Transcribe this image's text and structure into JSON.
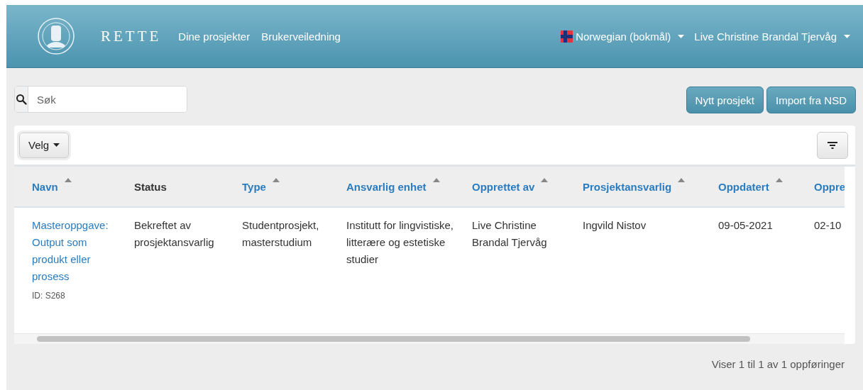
{
  "header": {
    "brand": "RETTE",
    "nav": [
      {
        "label": "Dine prosjekter"
      },
      {
        "label": "Brukerveiledning"
      }
    ],
    "language": "Norwegian (bokmål)",
    "user": "Live Christine Brandal Tjervåg"
  },
  "search": {
    "placeholder": "Søk"
  },
  "actions": [
    {
      "label": "Nytt prosjekt"
    },
    {
      "label": "Import fra NSD"
    }
  ],
  "table": {
    "select_button": "Velg",
    "columns": [
      {
        "label": "Navn",
        "link": true,
        "sortable": true
      },
      {
        "label": "Status",
        "link": false,
        "sortable": false
      },
      {
        "label": "Type",
        "link": true,
        "sortable": true
      },
      {
        "label": "Ansvarlig enhet",
        "link": true,
        "sortable": true
      },
      {
        "label": "Opprettet av",
        "link": true,
        "sortable": true
      },
      {
        "label": "Prosjektansvarlig",
        "link": true,
        "sortable": true
      },
      {
        "label": "Oppdatert",
        "link": true,
        "sortable": true
      },
      {
        "label": "Oppre",
        "link": true,
        "sortable": false
      }
    ],
    "rows": [
      {
        "id": "ID: S268",
        "cells": [
          "Masteroppgave: Output som produkt eller prosess",
          "Bekreftet av prosjektansvarlig",
          "Studentprosjekt, masterstudium",
          "Institutt for lingvistiske, litterære og estetiske studier",
          "Live Christine Brandal Tjervåg",
          "Ingvild Nistov",
          "09-05-2021",
          "02-10"
        ]
      }
    ]
  },
  "footer": "Viser 1 til 1 av 1 oppføringer"
}
